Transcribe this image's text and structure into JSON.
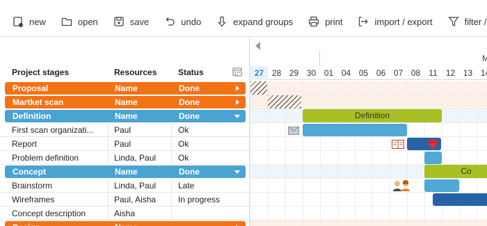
{
  "toolbar": {
    "new": "new",
    "open": "open",
    "save": "save",
    "undo": "undo",
    "expand": "expand groups",
    "print": "print",
    "import_export": "import / export",
    "filter": "filter / se"
  },
  "grid": {
    "col_stage": "Project stages",
    "col_resources": "Resources",
    "col_status": "Status"
  },
  "rows": [
    {
      "type": "group",
      "color": "#f47216",
      "stage": "Proposal",
      "resources": "Name",
      "status": "Done",
      "collapsed": true
    },
    {
      "type": "group",
      "color": "#f47216",
      "stage": "Martket scan",
      "resources": "Name",
      "status": "Done",
      "collapsed": true
    },
    {
      "type": "group",
      "color": "#4aa4d2",
      "stage": "Definition",
      "resources": "Name",
      "status": "Done",
      "collapsed": false
    },
    {
      "type": "data",
      "stage": "First scan organizati...",
      "resources": "Paul",
      "status": "Ok"
    },
    {
      "type": "data",
      "stage": "Report",
      "resources": "Paul",
      "status": "Ok"
    },
    {
      "type": "data",
      "stage": "Problem definition",
      "resources": "Linda, Paul",
      "status": "Ok"
    },
    {
      "type": "group",
      "color": "#4aa4d2",
      "stage": "Concept",
      "resources": "Name",
      "status": "Done",
      "collapsed": false
    },
    {
      "type": "data",
      "stage": "Brainstorm",
      "resources": "Linda, Paul",
      "status": "Late"
    },
    {
      "type": "data",
      "stage": "Wireframes",
      "resources": "Paul, Aisha",
      "status": "In progress"
    },
    {
      "type": "data",
      "stage": "Concept description",
      "resources": "Aisha",
      "status": ""
    },
    {
      "type": "group",
      "color": "#f47216",
      "stage": "Design",
      "resources": "Name",
      "status": "",
      "collapsed": true
    }
  ],
  "timeline": {
    "month_label": "M",
    "days": [
      "27",
      "28",
      "29",
      "30",
      "01",
      "04",
      "05",
      "06",
      "07",
      "08",
      "11",
      "12",
      "13",
      "14"
    ],
    "today_label": "27"
  },
  "bars": {
    "definition_label": "Definition",
    "concept_label": "Co",
    "colors": {
      "green": "#a8c023",
      "blue": "#4fa8d6",
      "dark_blue": "#2563a6",
      "orange": "#f47216",
      "light_blue": "#eef6fb"
    }
  },
  "icons": {
    "mail": "envelope-icon",
    "book": "book-icon",
    "gem": "ruby-icon",
    "people": "people-icon"
  }
}
